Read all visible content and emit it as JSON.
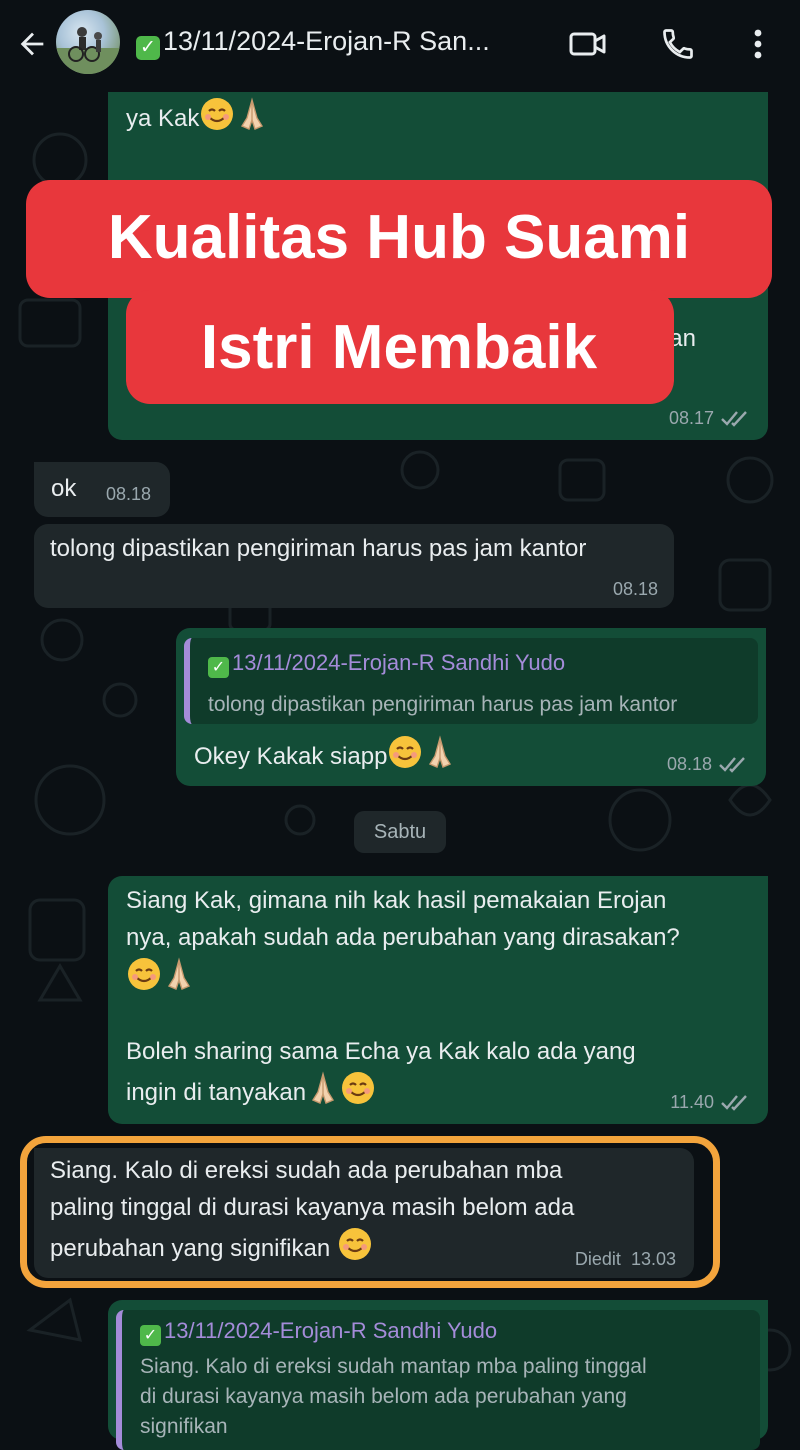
{
  "header": {
    "title": "13/11/2024-Erojan-R San...",
    "back_icon": "back-arrow-icon",
    "video_icon": "video-call-icon",
    "phone_icon": "phone-icon",
    "menu_icon": "more-vert-icon"
  },
  "banner": {
    "line1": "Kualitas Hub Suami",
    "line2": "Istri Membaik",
    "color": "#e8373c"
  },
  "messages": {
    "m1": {
      "text": "ya Kak",
      "partial": "an",
      "time": "08.17"
    },
    "m2": {
      "text": "ok",
      "time": "08.18"
    },
    "m3": {
      "text": "tolong dipastikan pengiriman harus pas jam kantor",
      "time": "08.18"
    },
    "m4": {
      "quote_author": "13/11/2024-Erojan-R Sandhi Yudo",
      "quote_text": "tolong dipastikan pengiriman harus pas jam kantor",
      "text": "Okey Kakak siapp",
      "time": "08.18"
    },
    "date_divider": "Sabtu",
    "m5": {
      "line1": "Siang Kak, gimana nih kak hasil pemakaian Erojan",
      "line2": "nya, apakah sudah ada perubahan yang dirasakan?",
      "line4": "Boleh sharing sama Echa ya Kak kalo ada yang",
      "line5": "ingin di tanyakan",
      "time": "11.40"
    },
    "m6": {
      "line1": "Siang. Kalo di ereksi sudah ada perubahan mba",
      "line2": "paling tinggal di durasi kayanya masih belom ada",
      "line3": "perubahan yang signifikan",
      "edited": "Diedit",
      "time": "13.03"
    },
    "m7": {
      "quote_author": "13/11/2024-Erojan-R Sandhi Yudo",
      "quote_line1": "Siang. Kalo di ereksi sudah mantap mba paling tinggal",
      "quote_line2": "di durasi kayanya masih belom ada perubahan yang",
      "quote_line3": "signifikan"
    }
  },
  "colors": {
    "outgoing_bubble": "#134d37",
    "incoming_bubble": "#1f272a",
    "highlight_border": "#f3a43c",
    "quote_accent": "#a48cd9",
    "background": "#0b1014"
  }
}
